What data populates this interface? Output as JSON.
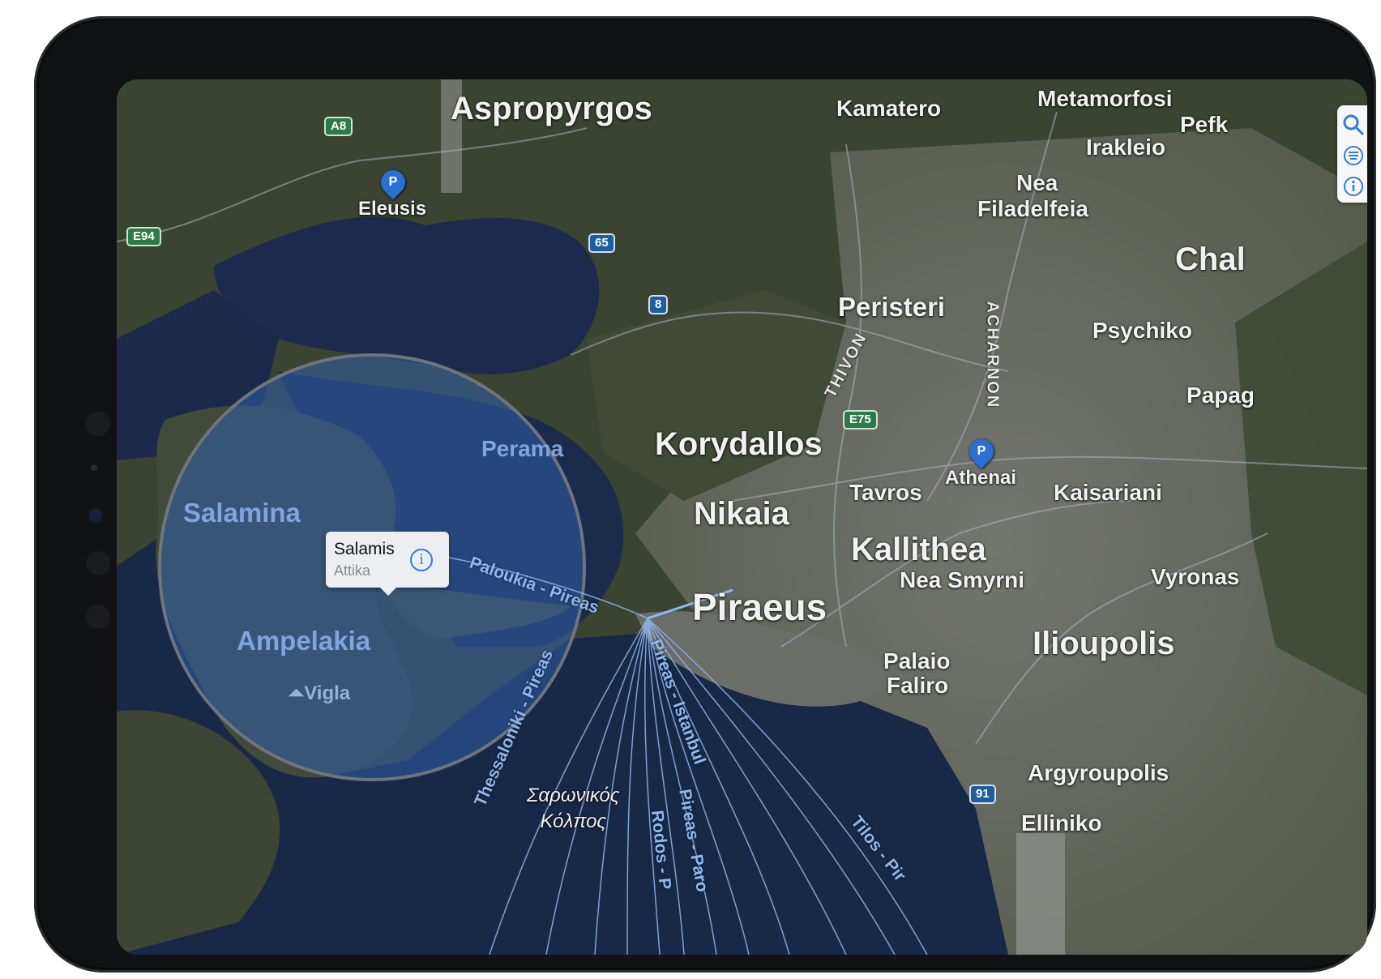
{
  "map": {
    "places": {
      "aspropyrgos": "Aspropyrgos",
      "kamatero": "Kamatero",
      "metamorfosi": "Metamorfosi",
      "pefki": "Pefk",
      "irakleio": "Irakleio",
      "nea_filadelfeia_1": "Nea",
      "nea_filadelfeia_2": "Filadelfeia",
      "chalandri": "Chal",
      "eleusis": "Eleusis",
      "peristeri": "Peristeri",
      "psychiko": "Psychiko",
      "papagou": "Papag",
      "perama": "Perama",
      "korydallos": "Korydallos",
      "athenai": "Athenai",
      "salamina": "Salamina",
      "tavros": "Tavros",
      "kaisariani": "Kaisariani",
      "nikaia": "Nikaia",
      "kallithea": "Kallithea",
      "vyronas": "Vyronas",
      "nea_smyrni": "Nea Smyrni",
      "piraeus": "Piraeus",
      "ampelakia": "Ampelakia",
      "ilioupolis": "Ilioupolis",
      "palaio_faliro_1": "Palaio",
      "palaio_faliro_2": "Faliro",
      "vigla": "Vigla",
      "argyroupolis": "Argyroupolis",
      "elliniko": "Elliniko",
      "saronic_1": "Σαρωνικός",
      "saronic_2": "Κόλπος"
    },
    "roads": {
      "thivon": "THIVON",
      "acharnon": "ACHARNON"
    },
    "shields": {
      "a8": "A8",
      "e94": "E94",
      "r65": "65",
      "r8": "8",
      "e75": "E75",
      "r91": "91"
    },
    "ferry_routes": {
      "paloukia_pireas": "Paloukia - Pireas",
      "thessaloniki_pireas": "Thessaloniki - Pireas",
      "pireas_istanbul": "Pireas - Istanbul",
      "rodos_p": "Rodos - P",
      "pireas_paro": "Pireas - Paro",
      "tilos_pir": "Tilos - Pir"
    },
    "pins": {
      "eleusis_pin": "P",
      "athenai_pin": "P"
    }
  },
  "callout": {
    "title": "Salamis",
    "subtitle": "Attika",
    "info_glyph": "i"
  },
  "colors": {
    "sea": "#1a2a4e",
    "land": "#3b4430",
    "urban": "#6a6c68",
    "radius_overlay": "#2f5ea8",
    "accent": "#2f7be0"
  },
  "tools": {
    "search_icon": "search-icon",
    "layers_icon": "layers-icon",
    "info_icon": "info-icon"
  }
}
